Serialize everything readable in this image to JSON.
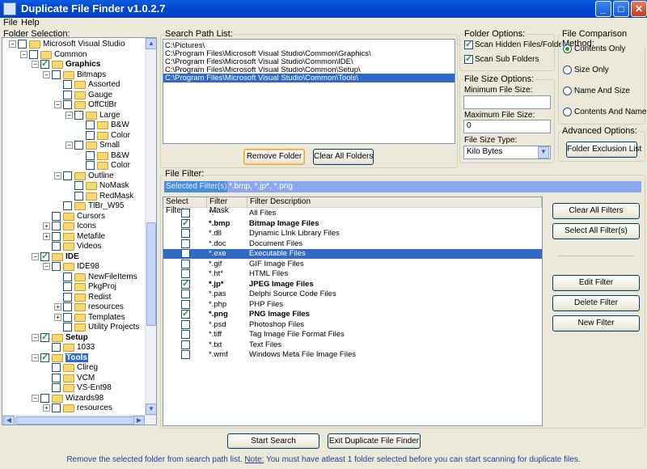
{
  "window": {
    "title": "Duplicate File Finder v1.0.2.7",
    "minimize": "_",
    "maximize": "□",
    "close": "✕"
  },
  "menu": [
    {
      "label": "File"
    },
    {
      "label": "Help"
    }
  ],
  "folder_selection": {
    "label": "Folder Selection:",
    "items": [
      {
        "label": "Microsoft Visual Studio",
        "depth": 1,
        "exp": "−",
        "checked": false,
        "bold": false
      },
      {
        "label": "Common",
        "depth": 2,
        "exp": "−",
        "checked": false,
        "bold": false
      },
      {
        "label": "Graphics",
        "depth": 3,
        "exp": "−",
        "checked": true,
        "bold": true
      },
      {
        "label": "Bitmaps",
        "depth": 4,
        "exp": "−",
        "checked": false,
        "bold": false
      },
      {
        "label": "Assorted",
        "depth": 5,
        "exp": "",
        "checked": false,
        "bold": false
      },
      {
        "label": "Gauge",
        "depth": 5,
        "exp": "",
        "checked": false,
        "bold": false
      },
      {
        "label": "OffCtlBr",
        "depth": 5,
        "exp": "−",
        "checked": false,
        "bold": false
      },
      {
        "label": "Large",
        "depth": 6,
        "exp": "−",
        "checked": false,
        "bold": false
      },
      {
        "label": "B&W",
        "depth": 7,
        "exp": "",
        "checked": false,
        "bold": false
      },
      {
        "label": "Color",
        "depth": 7,
        "exp": "",
        "checked": false,
        "bold": false
      },
      {
        "label": "Small",
        "depth": 6,
        "exp": "−",
        "checked": false,
        "bold": false
      },
      {
        "label": "B&W",
        "depth": 7,
        "exp": "",
        "checked": false,
        "bold": false
      },
      {
        "label": "Color",
        "depth": 7,
        "exp": "",
        "checked": false,
        "bold": false
      },
      {
        "label": "Outline",
        "depth": 5,
        "exp": "−",
        "checked": false,
        "bold": false
      },
      {
        "label": "NoMask",
        "depth": 6,
        "exp": "",
        "checked": false,
        "bold": false
      },
      {
        "label": "RedMask",
        "depth": 6,
        "exp": "",
        "checked": false,
        "bold": false
      },
      {
        "label": "TlBr_W95",
        "depth": 5,
        "exp": "",
        "checked": false,
        "bold": false
      },
      {
        "label": "Cursors",
        "depth": 4,
        "exp": "",
        "checked": false,
        "bold": false
      },
      {
        "label": "Icons",
        "depth": 4,
        "exp": "+",
        "checked": false,
        "bold": false
      },
      {
        "label": "Metafile",
        "depth": 4,
        "exp": "+",
        "checked": false,
        "bold": false
      },
      {
        "label": "Videos",
        "depth": 4,
        "exp": "",
        "checked": false,
        "bold": false
      },
      {
        "label": "IDE",
        "depth": 3,
        "exp": "−",
        "checked": true,
        "bold": true
      },
      {
        "label": "IDE98",
        "depth": 4,
        "exp": "−",
        "checked": false,
        "bold": false
      },
      {
        "label": "NewFileItems",
        "depth": 5,
        "exp": "",
        "checked": false,
        "bold": false
      },
      {
        "label": "PkgProj",
        "depth": 5,
        "exp": "",
        "checked": false,
        "bold": false
      },
      {
        "label": "Redist",
        "depth": 5,
        "exp": "",
        "checked": false,
        "bold": false
      },
      {
        "label": "resources",
        "depth": 5,
        "exp": "+",
        "checked": false,
        "bold": false
      },
      {
        "label": "Templates",
        "depth": 5,
        "exp": "+",
        "checked": false,
        "bold": false
      },
      {
        "label": "Utility Projects",
        "depth": 5,
        "exp": "",
        "checked": false,
        "bold": false
      },
      {
        "label": "Setup",
        "depth": 3,
        "exp": "−",
        "checked": true,
        "bold": true
      },
      {
        "label": "1033",
        "depth": 4,
        "exp": "",
        "checked": false,
        "bold": false
      },
      {
        "label": "Tools",
        "depth": 3,
        "exp": "−",
        "checked": true,
        "bold": true,
        "selected": true
      },
      {
        "label": "Clireg",
        "depth": 4,
        "exp": "",
        "checked": false,
        "bold": false
      },
      {
        "label": "VCM",
        "depth": 4,
        "exp": "",
        "checked": false,
        "bold": false
      },
      {
        "label": "VS-Ent98",
        "depth": 4,
        "exp": "",
        "checked": false,
        "bold": false
      },
      {
        "label": "Wizards98",
        "depth": 3,
        "exp": "−",
        "checked": false,
        "bold": false
      },
      {
        "label": "resources",
        "depth": 4,
        "exp": "+",
        "checked": false,
        "bold": false
      }
    ]
  },
  "search_path": {
    "label": "Search Path List:",
    "items": [
      {
        "path": "C:\\Pictures\\",
        "selected": false
      },
      {
        "path": "C:\\Program Files\\Microsoft Visual Studio\\Common\\Graphics\\",
        "selected": false
      },
      {
        "path": "C:\\Program Files\\Microsoft Visual Studio\\Common\\IDE\\",
        "selected": false
      },
      {
        "path": "C:\\Program Files\\Microsoft Visual Studio\\Common\\Setup\\",
        "selected": false
      },
      {
        "path": "C:\\Program Files\\Microsoft Visual Studio\\Common\\Tools\\",
        "selected": true
      }
    ],
    "remove_button": "Remove Folder",
    "clear_button": "Clear All Folders"
  },
  "folder_options": {
    "label": "Folder Options:",
    "hidden": {
      "label": "Scan Hidden Files/Folders",
      "checked": true
    },
    "sub": {
      "label": "Scan Sub Folders",
      "checked": true
    }
  },
  "file_size": {
    "label": "File Size Options:",
    "min_label": "Minimum File Size:",
    "min_value": "",
    "max_label": "Maximum File Size:",
    "max_value": "0",
    "type_label": "File Size Type:",
    "type_value": "Kilo Bytes"
  },
  "comparison": {
    "label": "File Comparison Method:",
    "options": [
      {
        "label": "Contents Only",
        "selected": true
      },
      {
        "label": "Size Only",
        "selected": false
      },
      {
        "label": "Name And Size",
        "selected": false
      },
      {
        "label": "Contents And Name",
        "selected": false
      }
    ]
  },
  "advanced": {
    "label": "Advanced Options:",
    "button": "Folder Exclusion List"
  },
  "file_filter": {
    "label": "File Filter:",
    "selected_label": "Selected Filter(s):",
    "selected_value": "*.bmp, *.jp*, *.png",
    "columns": [
      "Select Filter",
      "Filter Mask",
      "Filter Description"
    ],
    "rows": [
      {
        "mask": "*.*",
        "desc": "All Files",
        "checked": false,
        "bold": false,
        "selected": false
      },
      {
        "mask": "*.bmp",
        "desc": "Bitmap Image Files",
        "checked": true,
        "bold": true,
        "selected": false
      },
      {
        "mask": "*.dll",
        "desc": "Dynamic LInk Library Files",
        "checked": false,
        "bold": false,
        "selected": false
      },
      {
        "mask": "*.doc",
        "desc": "Document Files",
        "checked": false,
        "bold": false,
        "selected": false
      },
      {
        "mask": "*.exe",
        "desc": "Executable Files",
        "checked": false,
        "bold": false,
        "selected": true
      },
      {
        "mask": "*.gif",
        "desc": "GIF Image Files",
        "checked": false,
        "bold": false,
        "selected": false
      },
      {
        "mask": "*.ht*",
        "desc": "HTML Files",
        "checked": false,
        "bold": false,
        "selected": false
      },
      {
        "mask": "*.jp*",
        "desc": "JPEG Image Files",
        "checked": true,
        "bold": true,
        "selected": false
      },
      {
        "mask": "*.pas",
        "desc": "Delphi Source Code Files",
        "checked": false,
        "bold": false,
        "selected": false
      },
      {
        "mask": "*.php",
        "desc": "PHP Files",
        "checked": false,
        "bold": false,
        "selected": false
      },
      {
        "mask": "*.png",
        "desc": "PNG Image Files",
        "checked": true,
        "bold": true,
        "selected": false
      },
      {
        "mask": "*.psd",
        "desc": "Photoshop Files",
        "checked": false,
        "bold": false,
        "selected": false
      },
      {
        "mask": "*.tiff",
        "desc": "Tag Image File Format Files",
        "checked": false,
        "bold": false,
        "selected": false
      },
      {
        "mask": "*.txt",
        "desc": "Text Files",
        "checked": false,
        "bold": false,
        "selected": false
      },
      {
        "mask": "*.wmf",
        "desc": "Windows Meta File Image Files",
        "checked": false,
        "bold": false,
        "selected": false
      }
    ],
    "clear_all": "Clear All Filters",
    "select_all": "Select All Filter(s)",
    "edit": "Edit Filter",
    "delete": "Delete Filter",
    "new": "New Filter"
  },
  "actions": {
    "start": "Start Search",
    "exit": "Exit Duplicate File Finder"
  },
  "status": {
    "text": "Remove the selected folder from search path list.",
    "note_label": "Note:",
    "note": "You must have atleast 1 folder selected before you can start scanning for duplicate files."
  }
}
